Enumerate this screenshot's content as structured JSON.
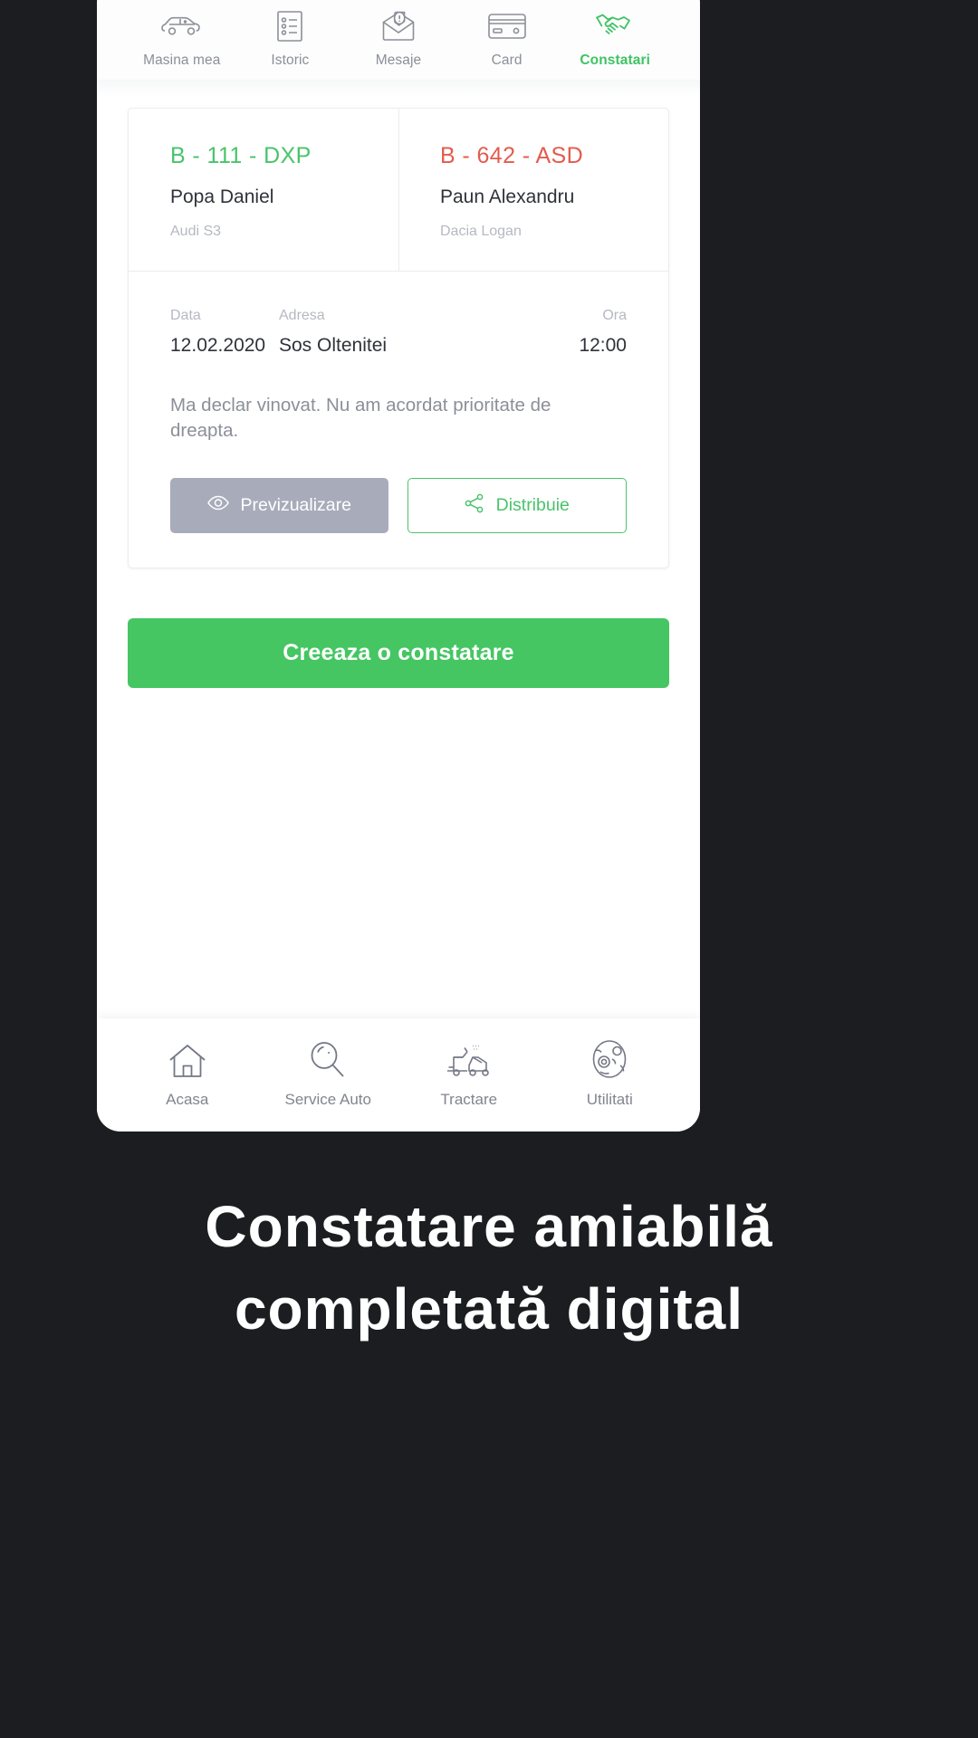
{
  "colors": {
    "accent_green": "#45c662",
    "plate_green": "#49c46a",
    "plate_red": "#e35b4d",
    "muted": "#b6b9c1",
    "text": "#30323a",
    "page_bg": "#1b1d21",
    "preview_btn": "#a8acba"
  },
  "top_nav": {
    "items": [
      {
        "label": "Masina mea",
        "icon": "car-icon",
        "active": false
      },
      {
        "label": "Istoric",
        "icon": "list-document-icon",
        "active": false
      },
      {
        "label": "Mesaje",
        "icon": "envelope-message-icon",
        "active": false
      },
      {
        "label": "Card",
        "icon": "credit-card-icon",
        "active": false
      },
      {
        "label": "Constatari",
        "icon": "handshake-icon",
        "active": true
      }
    ]
  },
  "report_card": {
    "party_a": {
      "plate": "B - 111 - DXP",
      "owner": "Popa Daniel",
      "model": "Audi S3"
    },
    "party_b": {
      "plate": "B - 642 - ASD",
      "owner": "Paun Alexandru",
      "model": "Dacia Logan"
    },
    "meta": {
      "date_label": "Data",
      "date_value": "12.02.2020",
      "address_label": "Adresa",
      "address_value": "Sos Oltenitei",
      "time_label": "Ora",
      "time_value": "12:00"
    },
    "declaration": "Ma declar vinovat. Nu am acordat prioritate de dreapta.",
    "preview_button": "Previzualizare",
    "share_button": "Distribuie"
  },
  "cta_button": {
    "label": "Creeaza o constatare"
  },
  "bottom_nav": {
    "items": [
      {
        "label": "Acasa",
        "icon": "home-icon"
      },
      {
        "label": "Service Auto",
        "icon": "magnifier-icon"
      },
      {
        "label": "Tractare",
        "icon": "tow-truck-icon"
      },
      {
        "label": "Utilitati",
        "icon": "globe-icon"
      }
    ]
  },
  "headline": {
    "line1": "Constatare amiabilă",
    "line2": "completată digital"
  }
}
